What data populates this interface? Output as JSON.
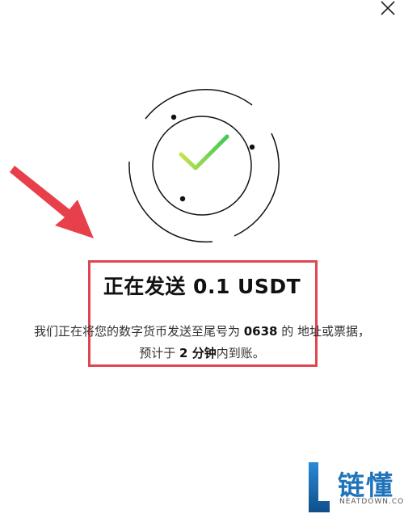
{
  "close_icon": "close-icon",
  "status_icon": "success-check-icon",
  "title": "正在发送 0.1 USDT",
  "description": {
    "part1": "我们正在将您的数字货币发送至尾号为 ",
    "tail_number": "0638",
    "part2": " 的 地址或票据，预计于 ",
    "eta": "2 分钟",
    "part3": "内到账。"
  },
  "watermark": {
    "letter": "L",
    "chinese": "链懂",
    "english": "NEATDOWN.COM"
  },
  "colors": {
    "highlight": "#e04552",
    "check_start": "#b8e04a",
    "check_end": "#3ec957",
    "watermark": "#1f73b8"
  }
}
